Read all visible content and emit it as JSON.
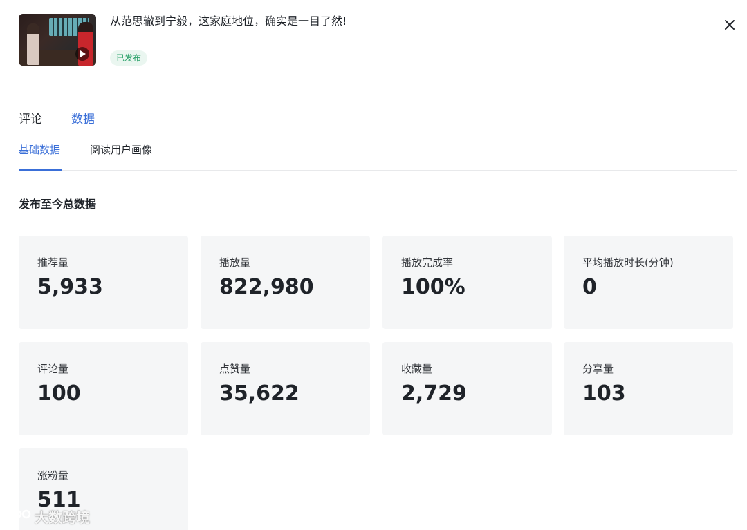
{
  "header": {
    "title": "从范思辙到宁毅，这家庭地位，确实是一目了然!",
    "status_badge": "已发布"
  },
  "icons": {
    "close": "close-icon",
    "play": "play-icon"
  },
  "tabs": [
    {
      "label": "评论",
      "active": false
    },
    {
      "label": "数据",
      "active": true
    }
  ],
  "subtabs": [
    {
      "label": "基础数据",
      "active": true
    },
    {
      "label": "阅读用户画像",
      "active": false
    }
  ],
  "section_title": "发布至今总数据",
  "stats": [
    {
      "label": "推荐量",
      "value": "5,933"
    },
    {
      "label": "播放量",
      "value": "822,980"
    },
    {
      "label": "播放完成率",
      "value": "100%"
    },
    {
      "label": "平均播放时长(分钟)",
      "value": "0"
    },
    {
      "label": "评论量",
      "value": "100"
    },
    {
      "label": "点赞量",
      "value": "35,622"
    },
    {
      "label": "收藏量",
      "value": "2,729"
    },
    {
      "label": "分享量",
      "value": "103"
    },
    {
      "label": "涨粉量",
      "value": "511"
    }
  ],
  "watermark": "大数跨境",
  "colors": {
    "accent": "#3a6fd8",
    "badge_bg": "#eaf6f0",
    "badge_text": "#2ea36c",
    "card_bg": "#f5f6f7"
  }
}
